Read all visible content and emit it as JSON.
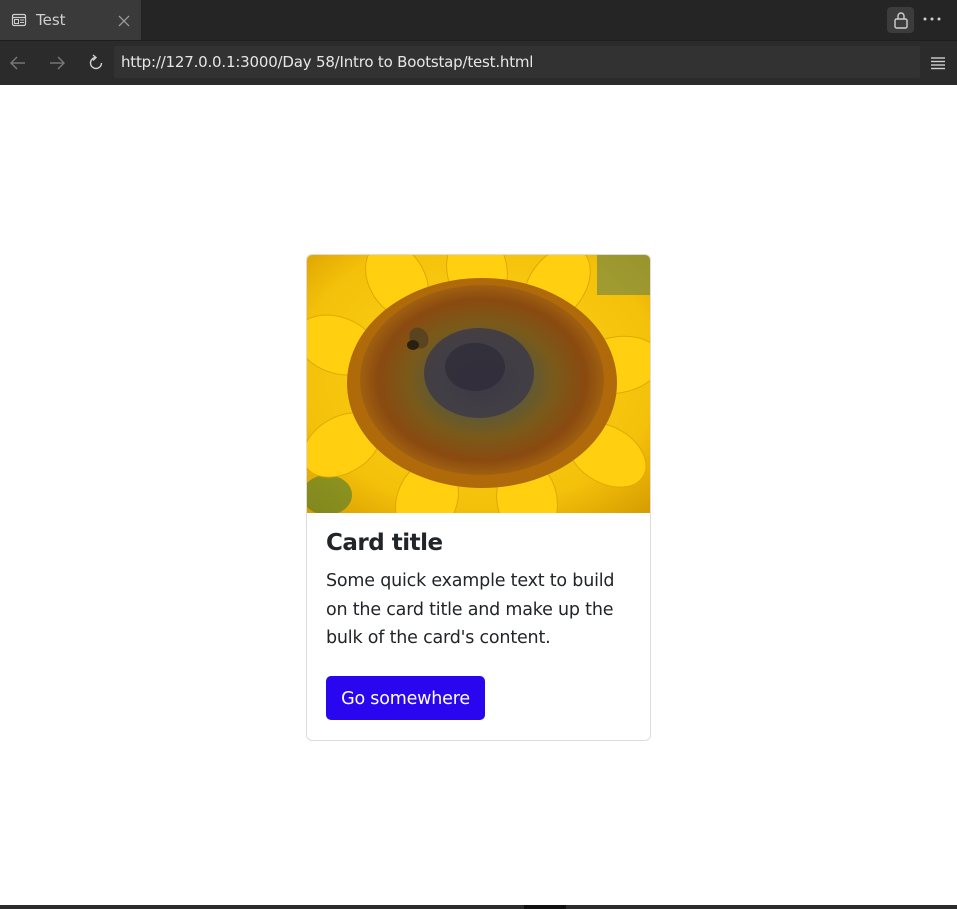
{
  "browser": {
    "tab": {
      "title": "Test",
      "icon": "reader-icon"
    },
    "url": "http://127.0.0.1:3000/Day 58/Intro to Bootstap/test.html",
    "colors": {
      "tabbar": "#252526",
      "active_tab": "#3a3a3a",
      "navbar": "#2b2b2b"
    }
  },
  "card": {
    "image": {
      "subject": "sunflower"
    },
    "title": "Card title",
    "text": "Some quick example text to build on the card title and make up the bulk of the card's content.",
    "button_label": "Go somewhere",
    "colors": {
      "button": "#2a06f0",
      "button_text": "#ffffff",
      "border": "#dcdcdc"
    }
  }
}
